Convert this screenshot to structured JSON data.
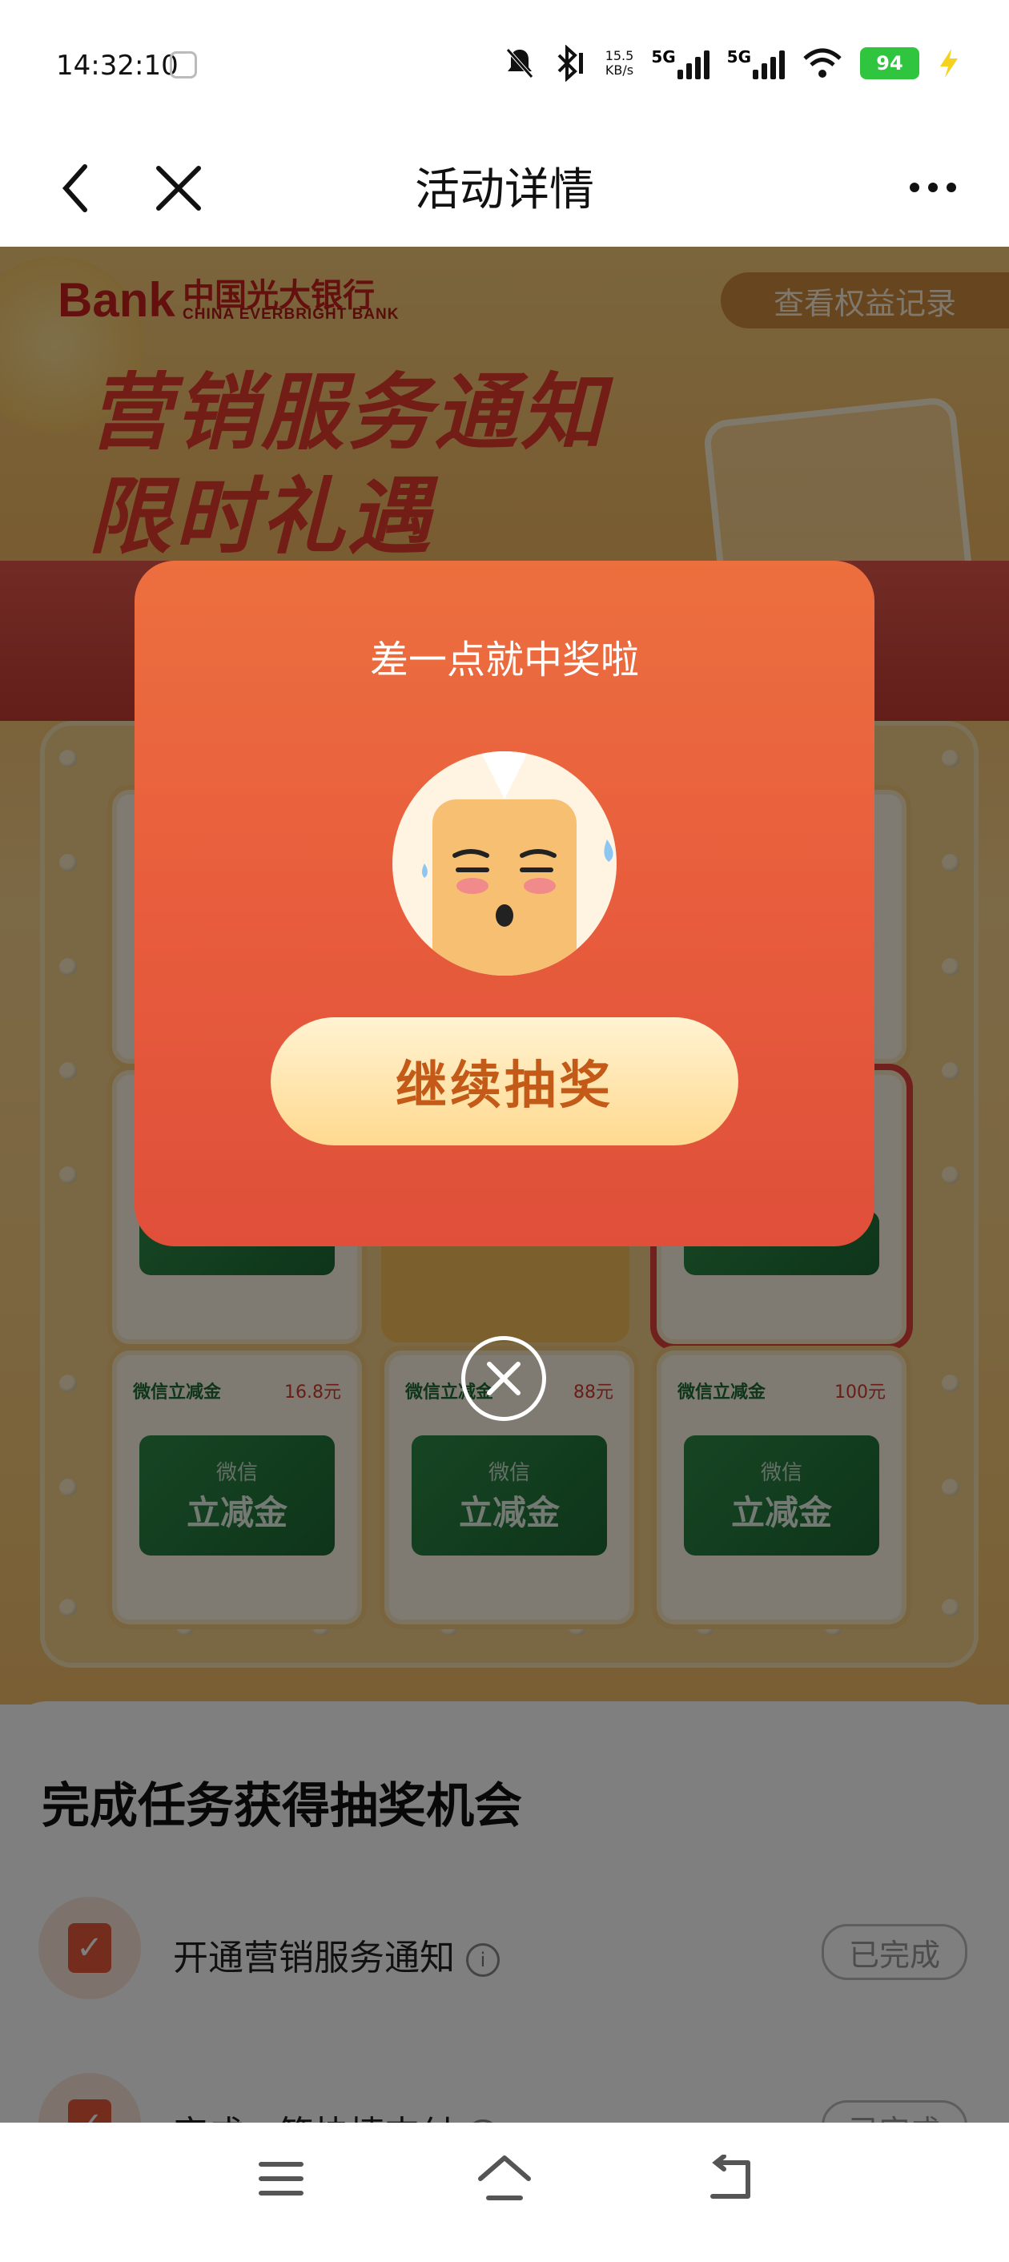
{
  "status_bar": {
    "time": "14:32:10",
    "net_speed_value": "15.5",
    "net_speed_unit": "KB/s",
    "net1": "5G",
    "net2": "5G",
    "battery": "94"
  },
  "nav": {
    "title": "活动详情"
  },
  "banner": {
    "bank_logo": "Bank",
    "bank_name_cn": "中国光大银行",
    "bank_name_en": "CHINA EVERBRIGHT BANK",
    "records_button": "查看权益记录",
    "headline_1": "营销服务通知",
    "headline_2": "限时礼遇"
  },
  "prizes": [
    {
      "name": "微信立减金",
      "amount": "16.8元",
      "voucher_small": "微信",
      "voucher_big": "立减金"
    },
    {
      "name": "微信立减金",
      "amount": "88元",
      "voucher_small": "微信",
      "voucher_big": "立减金"
    },
    {
      "name": "微信立减金",
      "amount": "100元",
      "voucher_small": "微信",
      "voucher_big": "立减金"
    }
  ],
  "modal": {
    "title": "差一点就中奖啦",
    "button": "继续抽奖"
  },
  "tasks": {
    "title": "完成任务获得抽奖机会",
    "items": [
      {
        "label": "开通营销服务通知",
        "info": "i",
        "status": "已完成"
      },
      {
        "label": "完成一笔快捷支付",
        "info": "i",
        "status": "已完成"
      }
    ]
  },
  "colors": {
    "modal": "#e85d3d",
    "button": "#ffd98f",
    "brand_red": "#c8201c",
    "done_green": "#2fc53f"
  }
}
